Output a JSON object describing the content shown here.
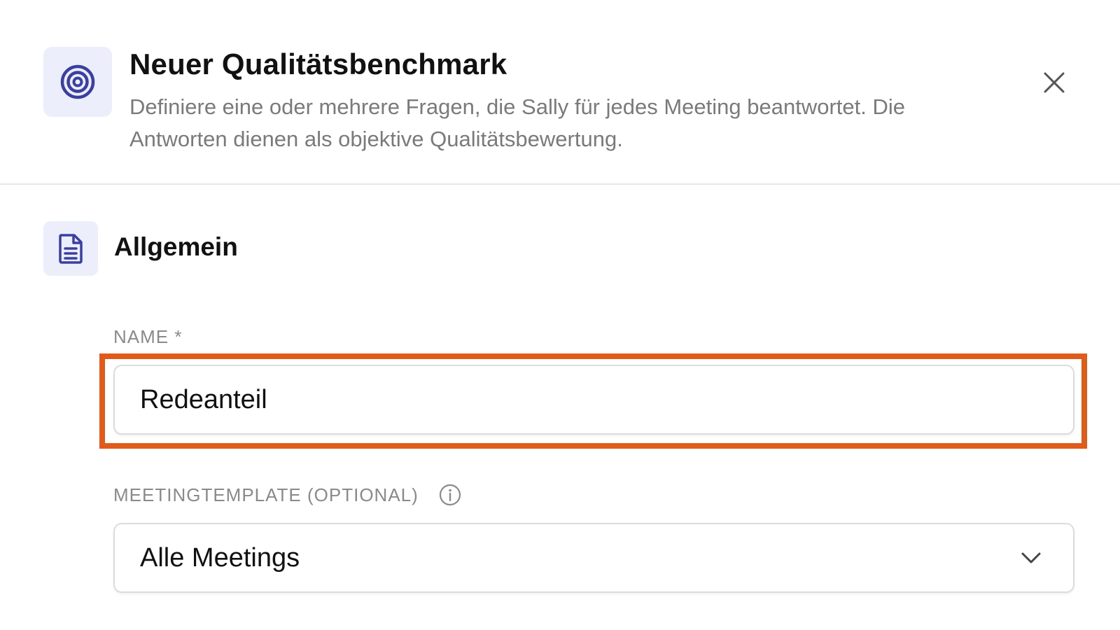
{
  "dialog": {
    "title": "Neuer Qualitätsbenchmark",
    "description": "Definiere eine oder mehrere Fragen, die Sally für jedes Meeting beantwortet. Die Antworten dienen als objektive Qualitätsbewertung.",
    "header_icon": "target-icon",
    "close_icon": "close-icon"
  },
  "section": {
    "title": "Allgemein",
    "icon": "document-icon"
  },
  "fields": {
    "name": {
      "label": "NAME *",
      "value": "Redeanteil"
    },
    "meeting_template": {
      "label": "MEETINGTEMPLATE (OPTIONAL)",
      "info_icon": "info-icon",
      "selected": "Alle Meetings",
      "chevron_icon": "chevron-down-icon"
    }
  },
  "colors": {
    "accent": "#3b3fa0",
    "icon_background": "#eceefc",
    "highlight": "#e05a1a",
    "muted_text": "#7a7a7a"
  }
}
